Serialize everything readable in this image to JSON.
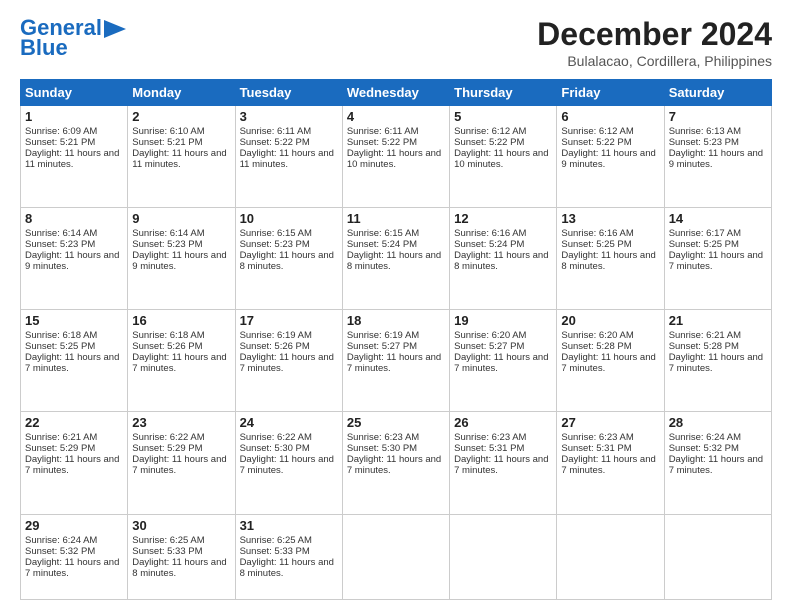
{
  "header": {
    "logo_line1": "General",
    "logo_line2": "Blue",
    "month": "December 2024",
    "location": "Bulalacao, Cordillera, Philippines"
  },
  "days_of_week": [
    "Sunday",
    "Monday",
    "Tuesday",
    "Wednesday",
    "Thursday",
    "Friday",
    "Saturday"
  ],
  "weeks": [
    [
      {
        "day": 1,
        "sunrise": "6:09 AM",
        "sunset": "5:21 PM",
        "daylight": "11 hours and 11 minutes."
      },
      {
        "day": 2,
        "sunrise": "6:10 AM",
        "sunset": "5:21 PM",
        "daylight": "11 hours and 11 minutes."
      },
      {
        "day": 3,
        "sunrise": "6:11 AM",
        "sunset": "5:22 PM",
        "daylight": "11 hours and 11 minutes."
      },
      {
        "day": 4,
        "sunrise": "6:11 AM",
        "sunset": "5:22 PM",
        "daylight": "11 hours and 10 minutes."
      },
      {
        "day": 5,
        "sunrise": "6:12 AM",
        "sunset": "5:22 PM",
        "daylight": "11 hours and 10 minutes."
      },
      {
        "day": 6,
        "sunrise": "6:12 AM",
        "sunset": "5:22 PM",
        "daylight": "11 hours and 9 minutes."
      },
      {
        "day": 7,
        "sunrise": "6:13 AM",
        "sunset": "5:23 PM",
        "daylight": "11 hours and 9 minutes."
      }
    ],
    [
      {
        "day": 8,
        "sunrise": "6:14 AM",
        "sunset": "5:23 PM",
        "daylight": "11 hours and 9 minutes."
      },
      {
        "day": 9,
        "sunrise": "6:14 AM",
        "sunset": "5:23 PM",
        "daylight": "11 hours and 9 minutes."
      },
      {
        "day": 10,
        "sunrise": "6:15 AM",
        "sunset": "5:23 PM",
        "daylight": "11 hours and 8 minutes."
      },
      {
        "day": 11,
        "sunrise": "6:15 AM",
        "sunset": "5:24 PM",
        "daylight": "11 hours and 8 minutes."
      },
      {
        "day": 12,
        "sunrise": "6:16 AM",
        "sunset": "5:24 PM",
        "daylight": "11 hours and 8 minutes."
      },
      {
        "day": 13,
        "sunrise": "6:16 AM",
        "sunset": "5:25 PM",
        "daylight": "11 hours and 8 minutes."
      },
      {
        "day": 14,
        "sunrise": "6:17 AM",
        "sunset": "5:25 PM",
        "daylight": "11 hours and 7 minutes."
      }
    ],
    [
      {
        "day": 15,
        "sunrise": "6:18 AM",
        "sunset": "5:25 PM",
        "daylight": "11 hours and 7 minutes."
      },
      {
        "day": 16,
        "sunrise": "6:18 AM",
        "sunset": "5:26 PM",
        "daylight": "11 hours and 7 minutes."
      },
      {
        "day": 17,
        "sunrise": "6:19 AM",
        "sunset": "5:26 PM",
        "daylight": "11 hours and 7 minutes."
      },
      {
        "day": 18,
        "sunrise": "6:19 AM",
        "sunset": "5:27 PM",
        "daylight": "11 hours and 7 minutes."
      },
      {
        "day": 19,
        "sunrise": "6:20 AM",
        "sunset": "5:27 PM",
        "daylight": "11 hours and 7 minutes."
      },
      {
        "day": 20,
        "sunrise": "6:20 AM",
        "sunset": "5:28 PM",
        "daylight": "11 hours and 7 minutes."
      },
      {
        "day": 21,
        "sunrise": "6:21 AM",
        "sunset": "5:28 PM",
        "daylight": "11 hours and 7 minutes."
      }
    ],
    [
      {
        "day": 22,
        "sunrise": "6:21 AM",
        "sunset": "5:29 PM",
        "daylight": "11 hours and 7 minutes."
      },
      {
        "day": 23,
        "sunrise": "6:22 AM",
        "sunset": "5:29 PM",
        "daylight": "11 hours and 7 minutes."
      },
      {
        "day": 24,
        "sunrise": "6:22 AM",
        "sunset": "5:30 PM",
        "daylight": "11 hours and 7 minutes."
      },
      {
        "day": 25,
        "sunrise": "6:23 AM",
        "sunset": "5:30 PM",
        "daylight": "11 hours and 7 minutes."
      },
      {
        "day": 26,
        "sunrise": "6:23 AM",
        "sunset": "5:31 PM",
        "daylight": "11 hours and 7 minutes."
      },
      {
        "day": 27,
        "sunrise": "6:23 AM",
        "sunset": "5:31 PM",
        "daylight": "11 hours and 7 minutes."
      },
      {
        "day": 28,
        "sunrise": "6:24 AM",
        "sunset": "5:32 PM",
        "daylight": "11 hours and 7 minutes."
      }
    ],
    [
      {
        "day": 29,
        "sunrise": "6:24 AM",
        "sunset": "5:32 PM",
        "daylight": "11 hours and 7 minutes."
      },
      {
        "day": 30,
        "sunrise": "6:25 AM",
        "sunset": "5:33 PM",
        "daylight": "11 hours and 8 minutes."
      },
      {
        "day": 31,
        "sunrise": "6:25 AM",
        "sunset": "5:33 PM",
        "daylight": "11 hours and 8 minutes."
      },
      null,
      null,
      null,
      null
    ]
  ]
}
